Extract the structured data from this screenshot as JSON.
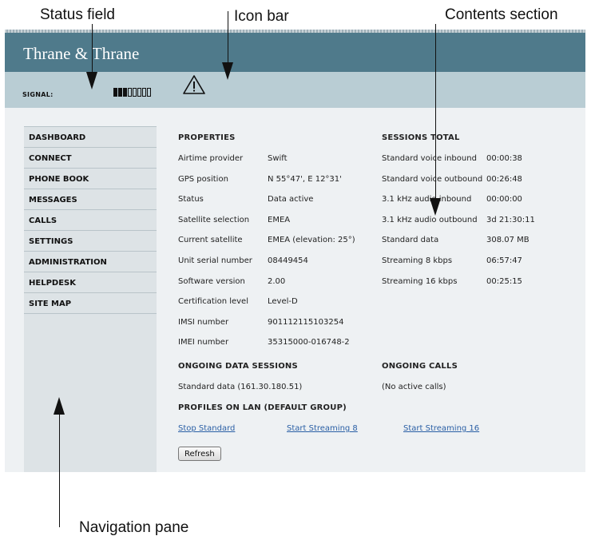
{
  "callouts": {
    "status_field": "Status field",
    "icon_bar": "Icon bar",
    "contents_section": "Contents section",
    "navigation_pane": "Navigation pane"
  },
  "header": {
    "brand": "Thrane & Thrane",
    "bg_color": "#4f7a8b"
  },
  "statusbar": {
    "signal_label": "SIGNAL:",
    "signal_filled": 3,
    "signal_total": 8,
    "bg_color": "#b9cdd4",
    "icon": "warning-icon"
  },
  "nav": {
    "items": [
      {
        "label": "DASHBOARD"
      },
      {
        "label": "CONNECT"
      },
      {
        "label": "PHONE BOOK"
      },
      {
        "label": "MESSAGES"
      },
      {
        "label": "CALLS"
      },
      {
        "label": "SETTINGS"
      },
      {
        "label": "ADMINISTRATION"
      },
      {
        "label": "HELPDESK"
      },
      {
        "label": "SITE MAP"
      }
    ]
  },
  "properties": {
    "title": "PROPERTIES",
    "rows": [
      {
        "label": "Airtime provider",
        "value": "Swift"
      },
      {
        "label": "GPS position",
        "value": "N 55°47', E 12°31'"
      },
      {
        "label": "Status",
        "value": "Data active"
      },
      {
        "label": "Satellite selection",
        "value": "EMEA"
      },
      {
        "label": "Current satellite",
        "value": "EMEA (elevation: 25°)"
      },
      {
        "label": "Unit serial number",
        "value": "08449454"
      },
      {
        "label": "Software version",
        "value": "2.00"
      },
      {
        "label": "Certification level",
        "value": "Level-D"
      },
      {
        "label": "IMSI number",
        "value": "901112115103254"
      },
      {
        "label": "IMEI number",
        "value": "35315000-016748-2"
      }
    ]
  },
  "sessions": {
    "title": "SESSIONS TOTAL",
    "rows": [
      {
        "label": "Standard voice inbound",
        "value": "00:00:38"
      },
      {
        "label": "Standard voice outbound",
        "value": "00:26:48"
      },
      {
        "label": "3.1 kHz audio inbound",
        "value": "00:00:00"
      },
      {
        "label": "3.1 kHz audio outbound",
        "value": "3d 21:30:11"
      },
      {
        "label": "Standard data",
        "value": "308.07 MB"
      },
      {
        "label": "Streaming 8 kbps",
        "value": "06:57:47"
      },
      {
        "label": "Streaming 16 kbps",
        "value": "00:25:15"
      }
    ]
  },
  "ongoing_data": {
    "title": "ONGOING DATA SESSIONS",
    "value": "Standard data (161.30.180.51)"
  },
  "ongoing_calls": {
    "title": "ONGOING CALLS",
    "value": "(No active calls)"
  },
  "profiles": {
    "title": "PROFILES ON LAN (DEFAULT GROUP)",
    "links": [
      "Stop Standard",
      "Start Streaming 8",
      "Start Streaming 16"
    ]
  },
  "refresh_label": "Refresh"
}
